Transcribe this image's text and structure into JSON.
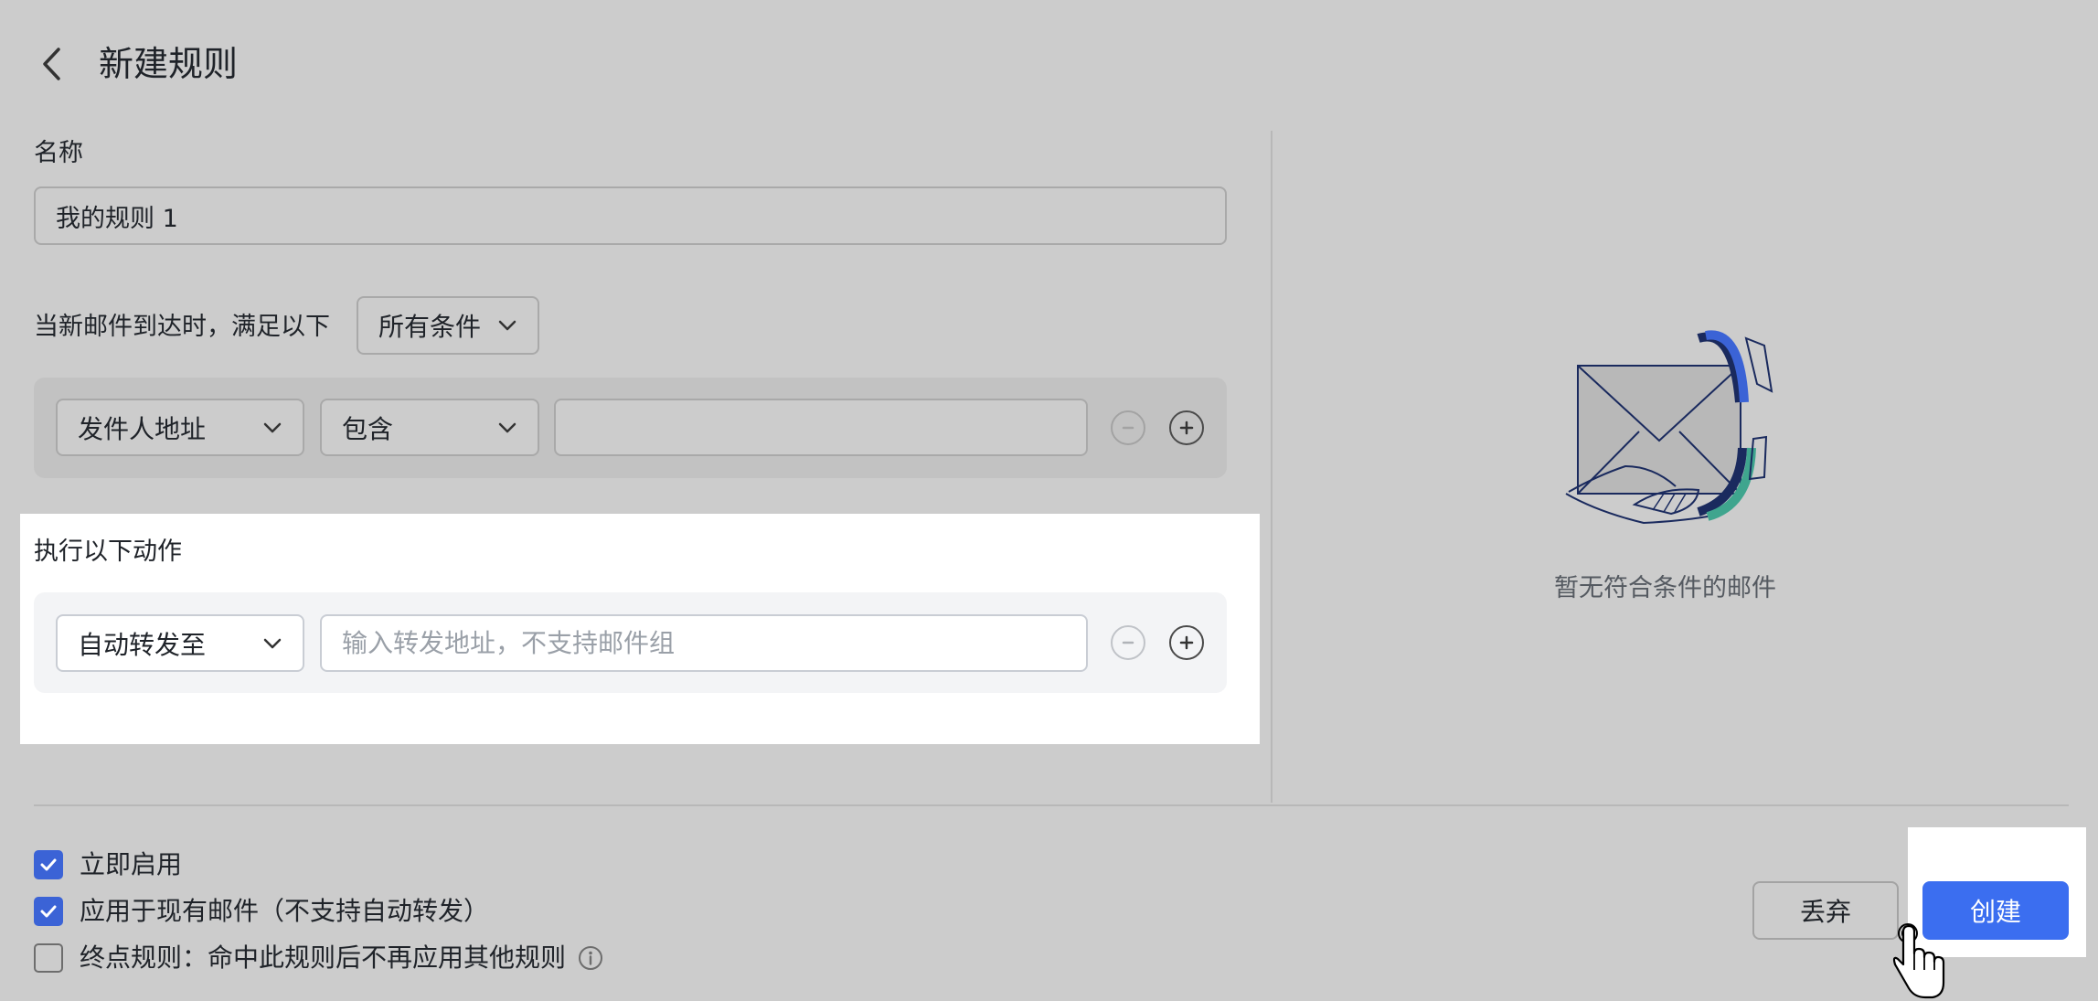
{
  "header": {
    "title": "新建规则",
    "back_icon": "chevron-left-icon"
  },
  "name_section": {
    "label": "名称",
    "value": "我的规则 1"
  },
  "conditions": {
    "label": "当新邮件到达时，满足以下",
    "match_mode": "所有条件",
    "rows": [
      {
        "field": "发件人地址",
        "operator": "包含",
        "value": ""
      }
    ]
  },
  "actions": {
    "label": "执行以下动作",
    "rows": [
      {
        "action": "自动转发至",
        "placeholder": "输入转发地址，不支持邮件组",
        "value": ""
      }
    ]
  },
  "preview": {
    "empty_text": "暂无符合条件的邮件",
    "illustration": "envelope-hand-illustration"
  },
  "options": [
    {
      "label": "立即启用",
      "checked": true
    },
    {
      "label": "应用于现有邮件（不支持自动转发）",
      "checked": true
    },
    {
      "label": "终点规则：命中此规则后不再应用其他规则",
      "checked": false,
      "info_icon": "info-icon"
    }
  ],
  "buttons": {
    "discard": "丢弃",
    "create": "创建"
  },
  "colors": {
    "primary": "#3b6ef0",
    "checkbox": "#3b63d6",
    "background": "#cccccc"
  }
}
